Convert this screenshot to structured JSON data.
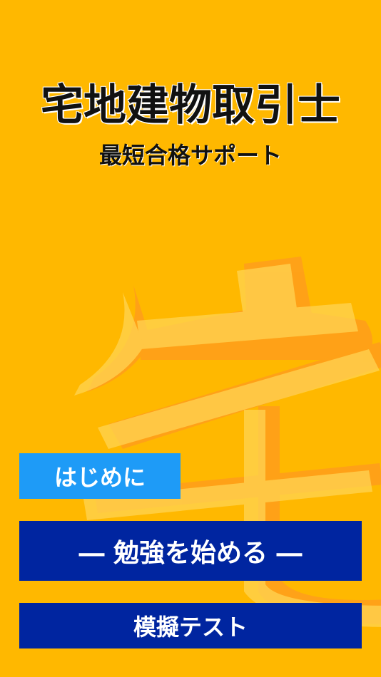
{
  "app": {
    "title": "宅地建物取引士",
    "subtitle": "最短合格サポート",
    "background_glyph": "宅"
  },
  "buttons": {
    "intro_label": "はじめに",
    "study_label": "― 勉強を始める ―",
    "exam_label": "模擬テスト"
  },
  "colors": {
    "background": "#FFB800",
    "intro_button": "#1E9BF7",
    "primary_button": "#0025A0",
    "button_text": "#FFFFFF",
    "title_text": "#111111"
  }
}
